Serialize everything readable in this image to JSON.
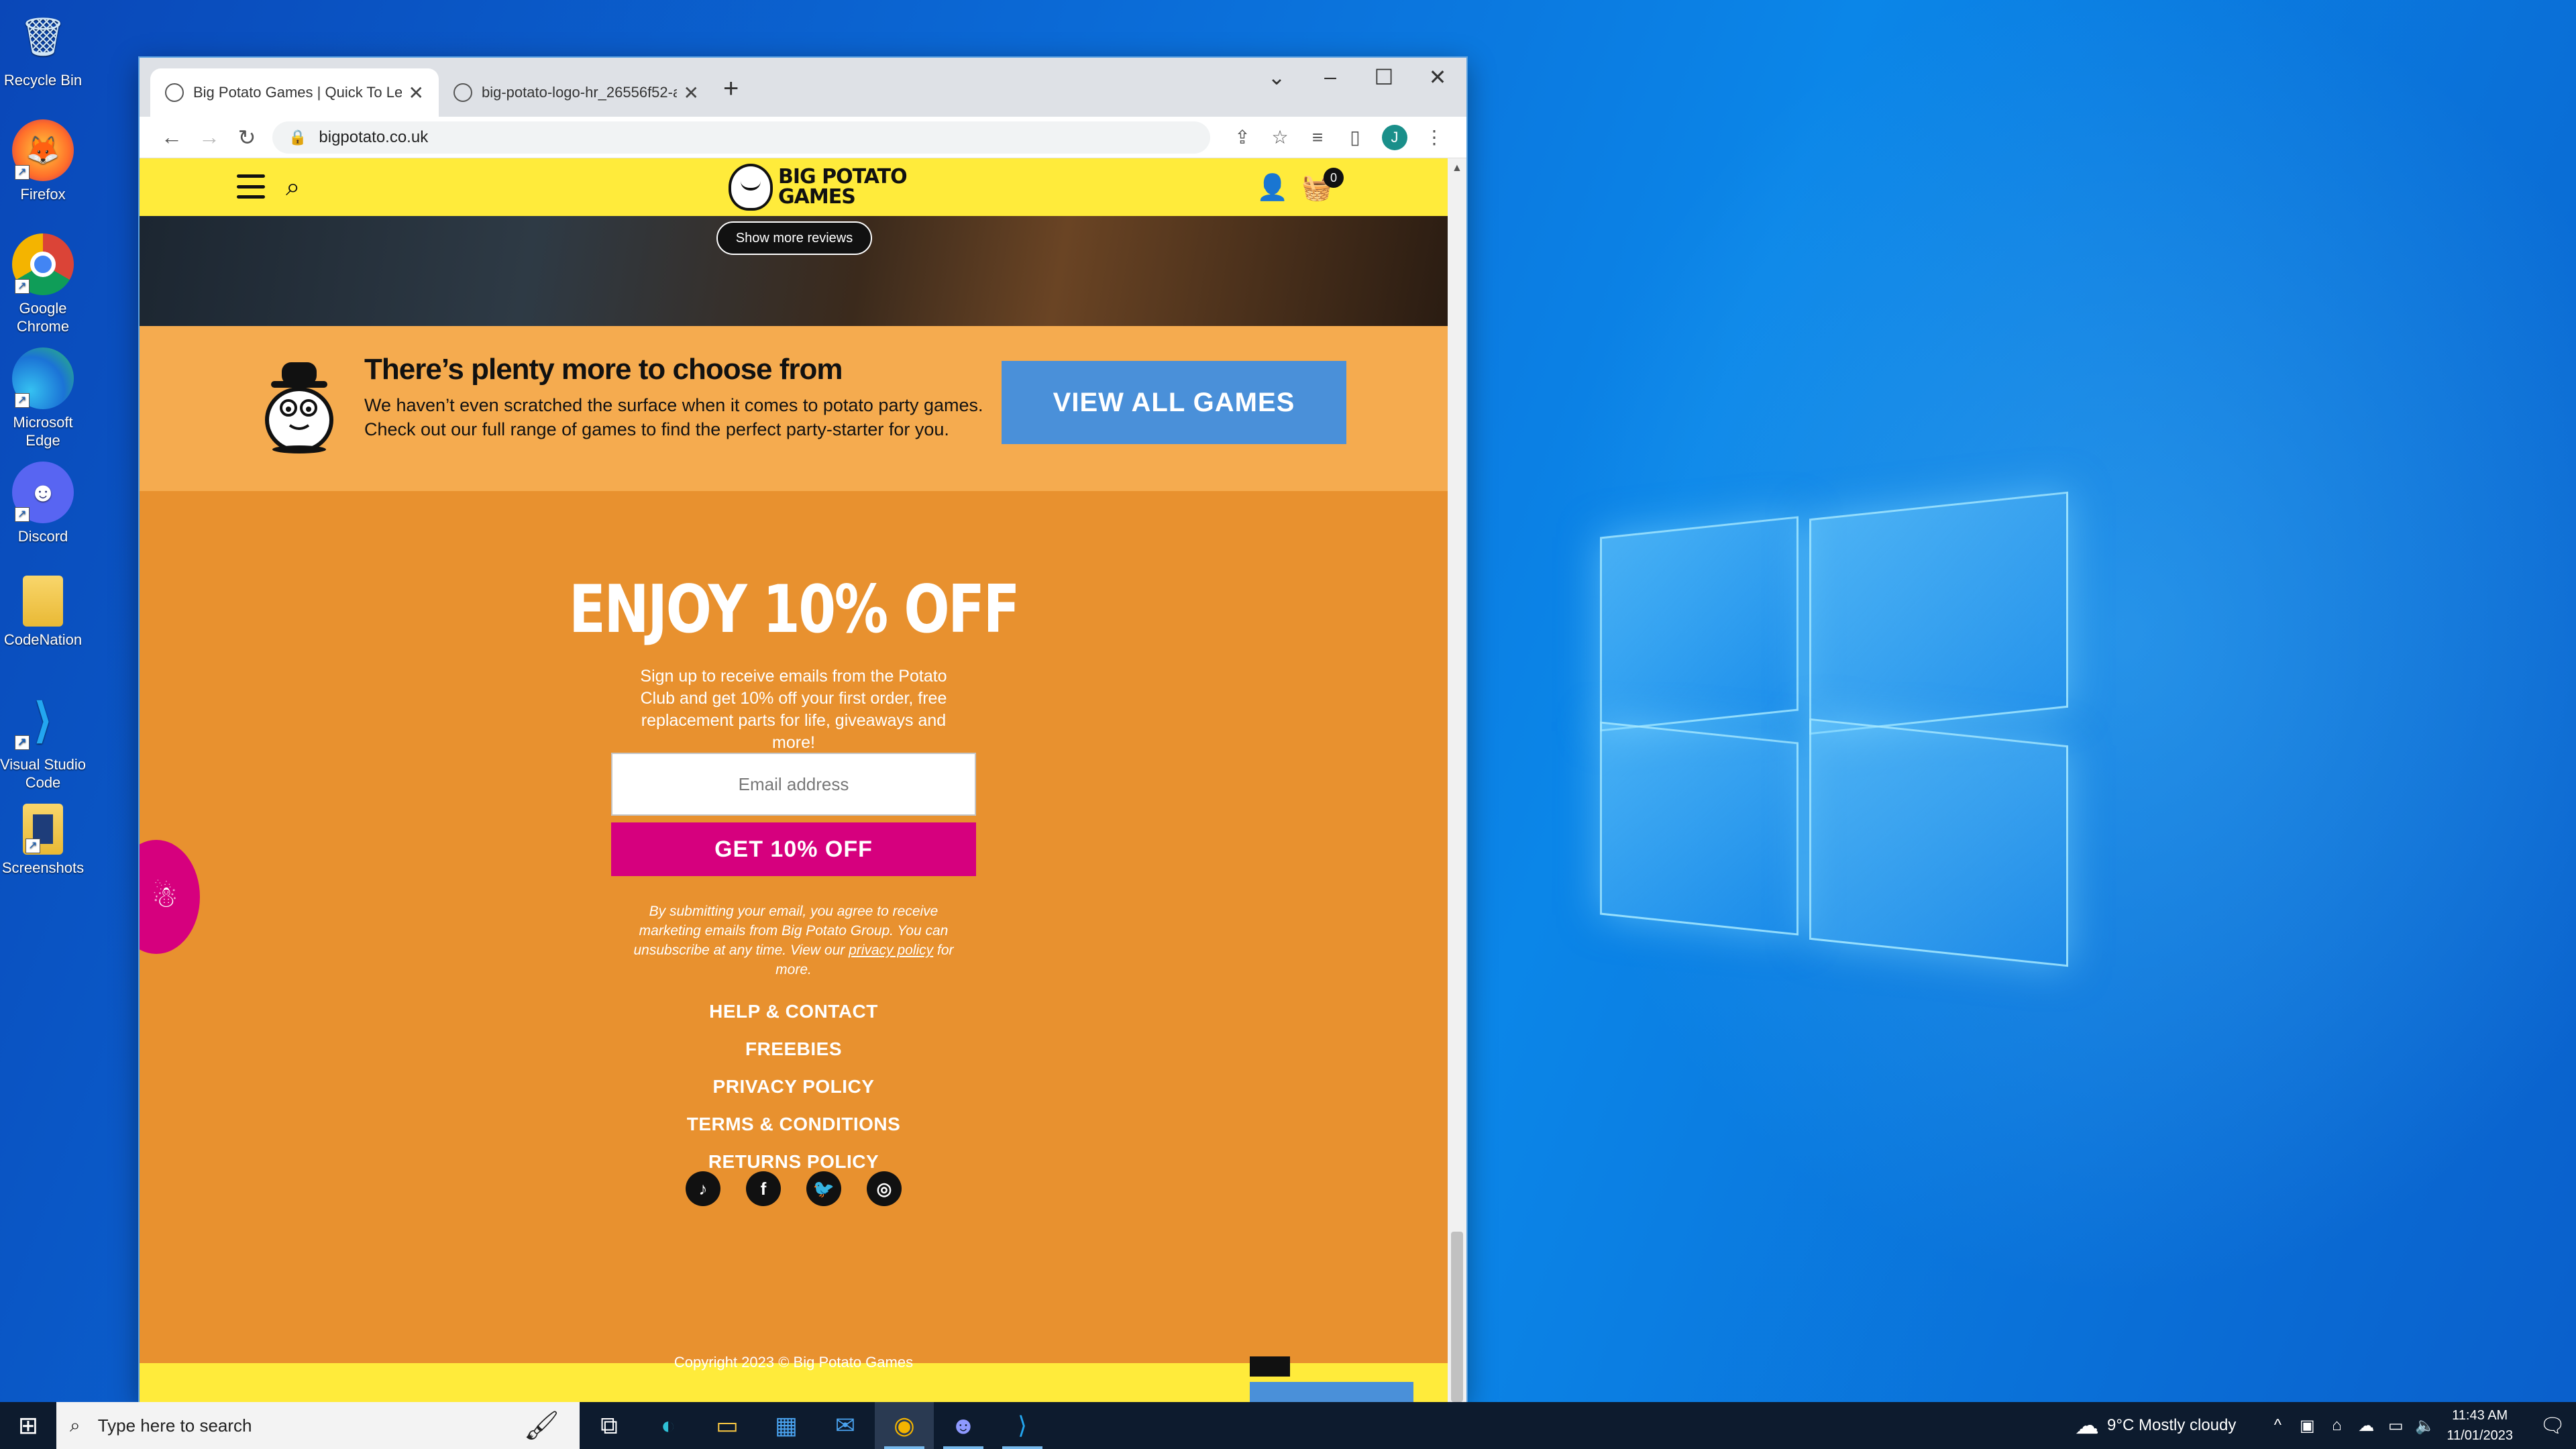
{
  "desktop": {
    "icons": [
      {
        "label": "Recycle Bin",
        "icon": "recycle-bin-icon"
      },
      {
        "label": "Firefox",
        "icon": "firefox-icon"
      },
      {
        "label": "Google Chrome",
        "icon": "chrome-icon"
      },
      {
        "label": "Microsoft Edge",
        "icon": "edge-icon"
      },
      {
        "label": "Discord",
        "icon": "discord-icon"
      },
      {
        "label": "CodeNation",
        "icon": "folder-icon"
      },
      {
        "label": "Visual Studio Code",
        "icon": "vscode-icon"
      },
      {
        "label": "Screenshots",
        "icon": "screenshots-icon"
      }
    ]
  },
  "browser": {
    "tabs": [
      {
        "title": "Big Potato Games | Quick To Lea",
        "active": true
      },
      {
        "title": "big-potato-logo-hr_26556f52-a9",
        "active": false
      }
    ],
    "url": "bigpotato.co.uk",
    "profile_initial": "J"
  },
  "site": {
    "logo_text_1": "BIG POTATO",
    "logo_text_2": "GAMES",
    "cart_count": "0",
    "show_more_reviews": "Show more reviews",
    "choose": {
      "heading": "There’s plenty more to choose from",
      "body": "We haven’t even scratched the surface when it comes to potato party games. Check out our full range of games to find the perfect party-starter for you.",
      "button": "VIEW ALL GAMES"
    },
    "newsletter": {
      "heading": "ENJOY 10% OFF",
      "lead": "Sign up to receive emails from the Potato Club and get 10% off your first order, free replacement parts for life, giveaways and more!",
      "email_placeholder": "Email address",
      "button": "GET 10% OFF",
      "disclaimer_pre": "By submitting your email, you agree to receive marketing emails from Big Potato Group. You can unsubscribe at any time. View our ",
      "disclaimer_link": "privacy policy",
      "disclaimer_post": " for more."
    },
    "footer_links": [
      "HELP & CONTACT",
      "FREEBIES",
      "PRIVACY POLICY",
      "TERMS & CONDITIONS",
      "RETURNS POLICY"
    ],
    "social": [
      "tiktok-icon",
      "facebook-icon",
      "twitter-icon",
      "instagram-icon"
    ],
    "copyright": "Copyright 2023 © Big Potato Games"
  },
  "taskbar": {
    "search_placeholder": "Type here to search",
    "weather": "9°C  Mostly cloudy",
    "time": "11:43 AM",
    "date": "11/01/2023"
  }
}
